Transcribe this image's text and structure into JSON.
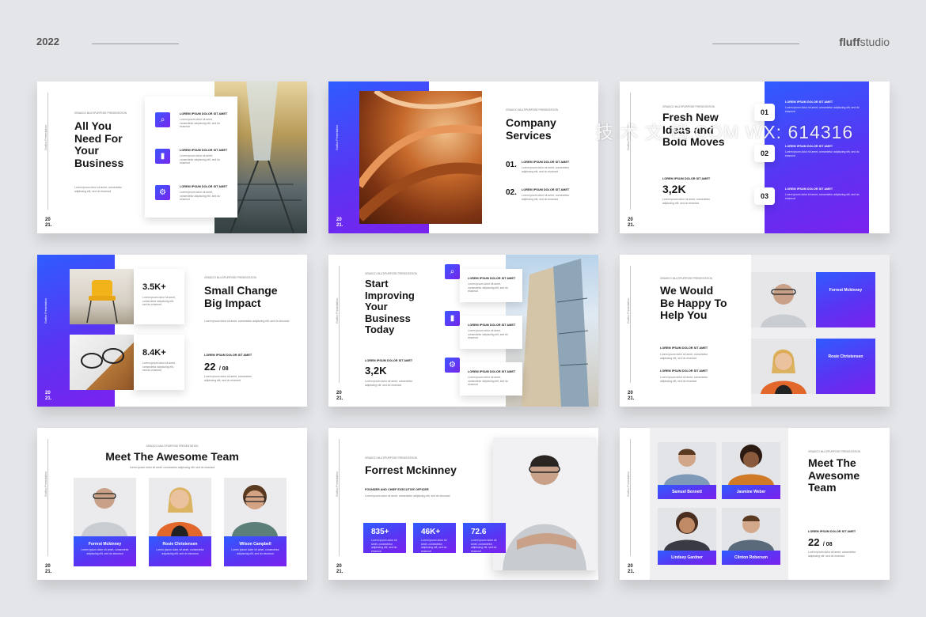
{
  "header": {
    "year": "2022",
    "brand_bold": "fluff",
    "brand_rest": "studio"
  },
  "watermark": "技 术 文 档.COM WX: 614316",
  "common": {
    "side_label": "Grafico Presentation",
    "year_a": "20",
    "year_b": "21.",
    "kicker": "GRADICO MULTIPURPOSE PRESENTATION",
    "lorem_head": "LOREM IPSUM DOLOR SIT AMET",
    "lorem_body": "Lorem ipsum dolor sit amet, consectetur adipiscing elit, sed do eiusmod"
  },
  "s1": {
    "title": "All You\nNeed For\nYour\nBusiness"
  },
  "s2": {
    "title": "Company\nServices",
    "n1": "01.",
    "n2": "02."
  },
  "s3": {
    "title": "Fresh New\nIdeas and\nBold Moves",
    "stat": "3,2K",
    "n1": "01",
    "n2": "02",
    "n3": "03"
  },
  "s4": {
    "stat1": "3.5K+",
    "stat2": "8.4K+",
    "title": "Small Change\nBig Impact",
    "page": "22",
    "page_of": "/ 08"
  },
  "s5": {
    "title": "Start\nImproving\nYour\nBusiness\nToday",
    "stat": "3,2K"
  },
  "s6": {
    "title": "We Would\nBe Happy To\nHelp You",
    "name1": "Forrest Mckinney",
    "name2": "Rosie Christensen"
  },
  "s7": {
    "title": "Meet The Awesome Team",
    "names": [
      "Forrest Mckinney",
      "Rosie Christensen",
      "Wilson Campbell"
    ]
  },
  "s8": {
    "title": "Forrest Mckinney",
    "role": "FOUNDER AND CHIEF EXECUTIVE OFFICER",
    "stats": [
      "835+",
      "46K+",
      "72.6"
    ]
  },
  "s9": {
    "title": "Meet The\nAwesome\nTeam",
    "names": [
      "Samuel Bennett",
      "Jasmine Weber",
      "Lindsey Gardner",
      "Clinton Roberson"
    ],
    "page": "22",
    "page_of": "/ 08"
  },
  "icons": [
    "search-icon",
    "building-icon",
    "gear-icon"
  ],
  "colors": {
    "accent_blue": "#2f5cff",
    "accent_purple": "#7b22ee",
    "background": "#e4e5e9"
  }
}
